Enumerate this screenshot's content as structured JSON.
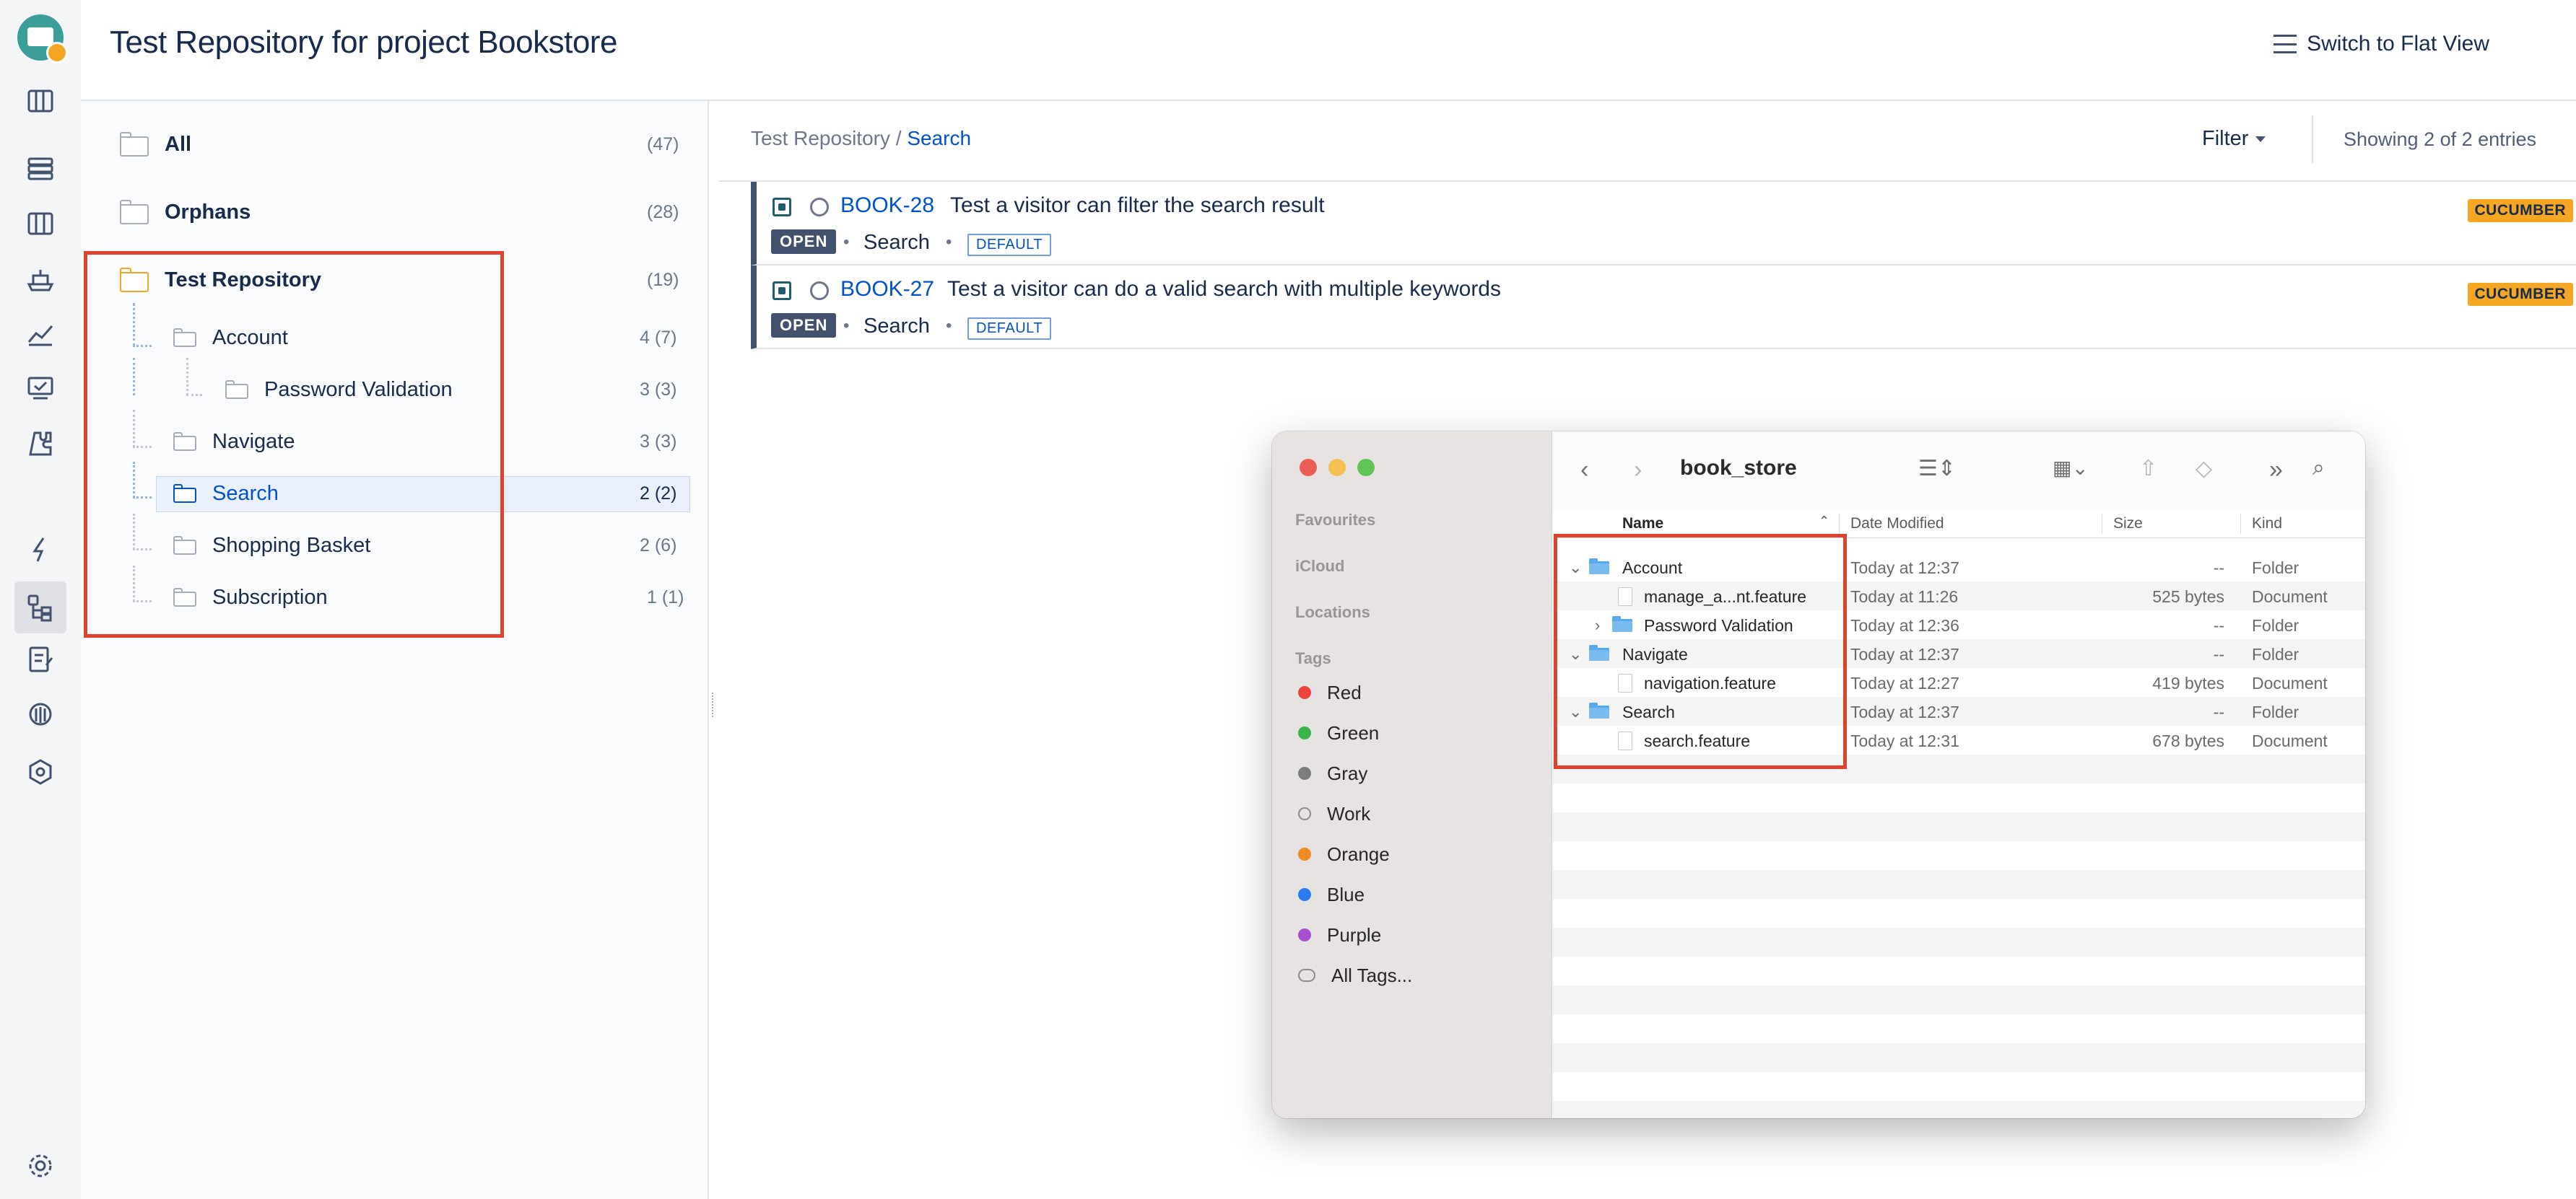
{
  "header": {
    "title": "Test Repository for project Bookstore",
    "switch_view": "Switch to Flat View"
  },
  "tree": {
    "all": {
      "label": "All",
      "count": "(47)"
    },
    "orphans": {
      "label": "Orphans",
      "count": "(28)"
    },
    "root": {
      "label": "Test Repository",
      "count": "(19)"
    },
    "items": [
      {
        "label": "Account",
        "count": "4 (7)"
      },
      {
        "label": "Password Validation",
        "count": "3 (3)"
      },
      {
        "label": "Navigate",
        "count": "3 (3)"
      },
      {
        "label": "Search",
        "count": "2 (2)"
      },
      {
        "label": "Shopping Basket",
        "count": "2 (6)"
      },
      {
        "label": "Subscription",
        "count": "1 (1)"
      }
    ]
  },
  "main": {
    "breadcrumb_root": "Test Repository",
    "breadcrumb_sep": " / ",
    "breadcrumb_current": "Search",
    "filter": "Filter",
    "showing": "Showing 2 of 2 entries",
    "entries": [
      {
        "key": "BOOK-28",
        "title": "Test a visitor can filter the search result",
        "status": "OPEN",
        "folder": "Search",
        "config": "DEFAULT",
        "tag": "CUCUMBER"
      },
      {
        "key": "BOOK-27",
        "title": "Test a visitor can do a valid search with multiple keywords",
        "status": "OPEN",
        "folder": "Search",
        "config": "DEFAULT",
        "tag": "CUCUMBER"
      }
    ]
  },
  "finder": {
    "title": "book_store",
    "sidebar": {
      "favourites": "Favourites",
      "icloud": "iCloud",
      "locations": "Locations",
      "tags_header": "Tags",
      "tags": [
        {
          "label": "Red",
          "color": "#e8453c"
        },
        {
          "label": "Green",
          "color": "#3ab54a"
        },
        {
          "label": "Gray",
          "color": "#7d7d7d"
        },
        {
          "label": "Work",
          "color": "none"
        },
        {
          "label": "Orange",
          "color": "#f08a24"
        },
        {
          "label": "Blue",
          "color": "#2b7bf0"
        },
        {
          "label": "Purple",
          "color": "#a64fd0"
        },
        {
          "label": "All Tags...",
          "color": "all"
        }
      ]
    },
    "columns": {
      "name": "Name",
      "date": "Date Modified",
      "size": "Size",
      "kind": "Kind"
    },
    "rows": [
      {
        "name": "Account",
        "date": "Today at 12:37",
        "size": "--",
        "kind": "Folder"
      },
      {
        "name": "manage_a...nt.feature",
        "date": "Today at 11:26",
        "size": "525 bytes",
        "kind": "Document"
      },
      {
        "name": "Password Validation",
        "date": "Today at 12:36",
        "size": "--",
        "kind": "Folder"
      },
      {
        "name": "Navigate",
        "date": "Today at 12:37",
        "size": "--",
        "kind": "Folder"
      },
      {
        "name": "navigation.feature",
        "date": "Today at 12:27",
        "size": "419 bytes",
        "kind": "Document"
      },
      {
        "name": "Search",
        "date": "Today at 12:37",
        "size": "--",
        "kind": "Folder"
      },
      {
        "name": "search.feature",
        "date": "Today at 12:31",
        "size": "678 bytes",
        "kind": "Document"
      }
    ]
  }
}
